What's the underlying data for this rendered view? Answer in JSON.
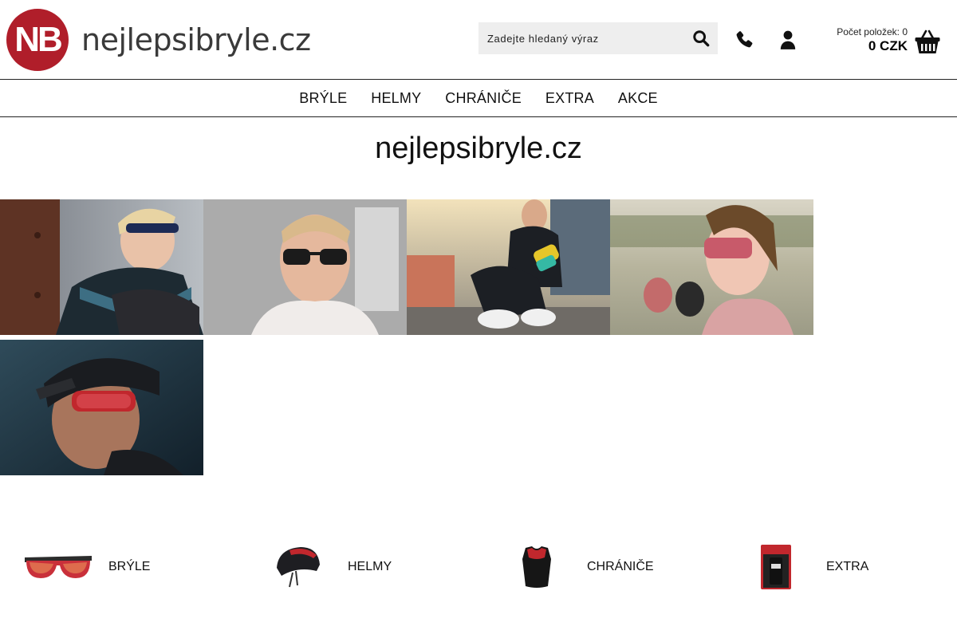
{
  "header": {
    "logo_initials": "NB",
    "logo_text": "nejlepsibryle.cz",
    "search_placeholder": "Zadejte hledaný výraz",
    "cart_count_label": "Počet položek: 0",
    "cart_total": "0 CZK"
  },
  "nav": [
    {
      "label": "BRÝLE"
    },
    {
      "label": "HELMY"
    },
    {
      "label": "CHRÁNIČE"
    },
    {
      "label": "EXTRA"
    },
    {
      "label": "AKCE"
    }
  ],
  "page_title": "nejlepsibryle.cz",
  "categories": [
    {
      "label": "BRÝLE"
    },
    {
      "label": "HELMY"
    },
    {
      "label": "CHRÁNIČE"
    },
    {
      "label": "EXTRA"
    }
  ],
  "colors": {
    "brand": "#b01e2a",
    "search_bg": "#eeeeee"
  }
}
